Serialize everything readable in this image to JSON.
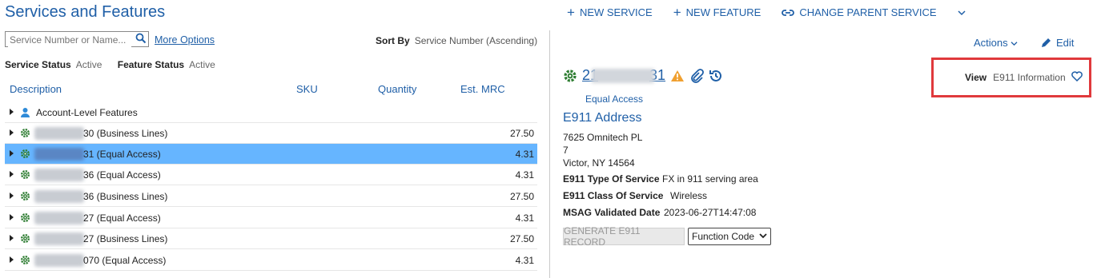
{
  "page": {
    "title": "Services and Features"
  },
  "toolbar": {
    "new_service": "NEW SERVICE",
    "new_feature": "NEW FEATURE",
    "change_parent": "CHANGE PARENT SERVICE"
  },
  "search": {
    "placeholder": "Service Number or Name...",
    "more_options": "More Options"
  },
  "sort": {
    "label": "Sort By",
    "value": "Service Number (Ascending)"
  },
  "filters": {
    "service_status_label": "Service Status",
    "service_status_value": "Active",
    "feature_status_label": "Feature Status",
    "feature_status_value": "Active"
  },
  "table": {
    "columns": [
      "Description",
      "SKU",
      "Quantity",
      "Est. MRC"
    ],
    "rows": [
      {
        "desc": "Account-Level Features",
        "mrc": "",
        "icon": "person-icon"
      },
      {
        "desc": "30 (Business Lines)",
        "mrc": "27.50",
        "icon": "gear-icon"
      },
      {
        "desc": "31 (Equal Access)",
        "mrc": "4.31",
        "icon": "gear-icon"
      },
      {
        "desc": "36 (Equal Access)",
        "mrc": "4.31",
        "icon": "gear-icon"
      },
      {
        "desc": "36 (Business Lines)",
        "mrc": "27.50",
        "icon": "gear-icon"
      },
      {
        "desc": "27 (Equal Access)",
        "mrc": "4.31",
        "icon": "gear-icon"
      },
      {
        "desc": "27 (Business Lines)",
        "mrc": "27.50",
        "icon": "gear-icon"
      },
      {
        "desc": "070 (Equal Access)",
        "mrc": "4.31",
        "icon": "gear-icon"
      }
    ]
  },
  "detail": {
    "actions": "Actions",
    "edit": "Edit",
    "service_number": "21",
    "service_number_end": "31",
    "service_type": "Equal Access",
    "section_title": "E911 Address",
    "address_line1": "7625 Omnitech PL",
    "address_line2": "7",
    "address_line3": "Victor, NY 14564",
    "type_of_service_label": "E911 Type Of Service",
    "type_of_service_value": "FX in 911 serving area",
    "class_of_service_label": "E911 Class Of Service",
    "class_of_service_value": "Wireless",
    "msag_label": "MSAG Validated Date",
    "msag_value": "2023-06-27T14:47:08",
    "generate_button": "GENERATE E911 RECORD",
    "function_select": "Function Code",
    "view_label": "View",
    "view_value": "E911 Information"
  },
  "colors": {
    "accent": "#1f5fa7",
    "selected_row": "#66b5ff",
    "gear": "#2e7d32",
    "warning": "#f0a030",
    "highlight_box": "#e0393c"
  }
}
